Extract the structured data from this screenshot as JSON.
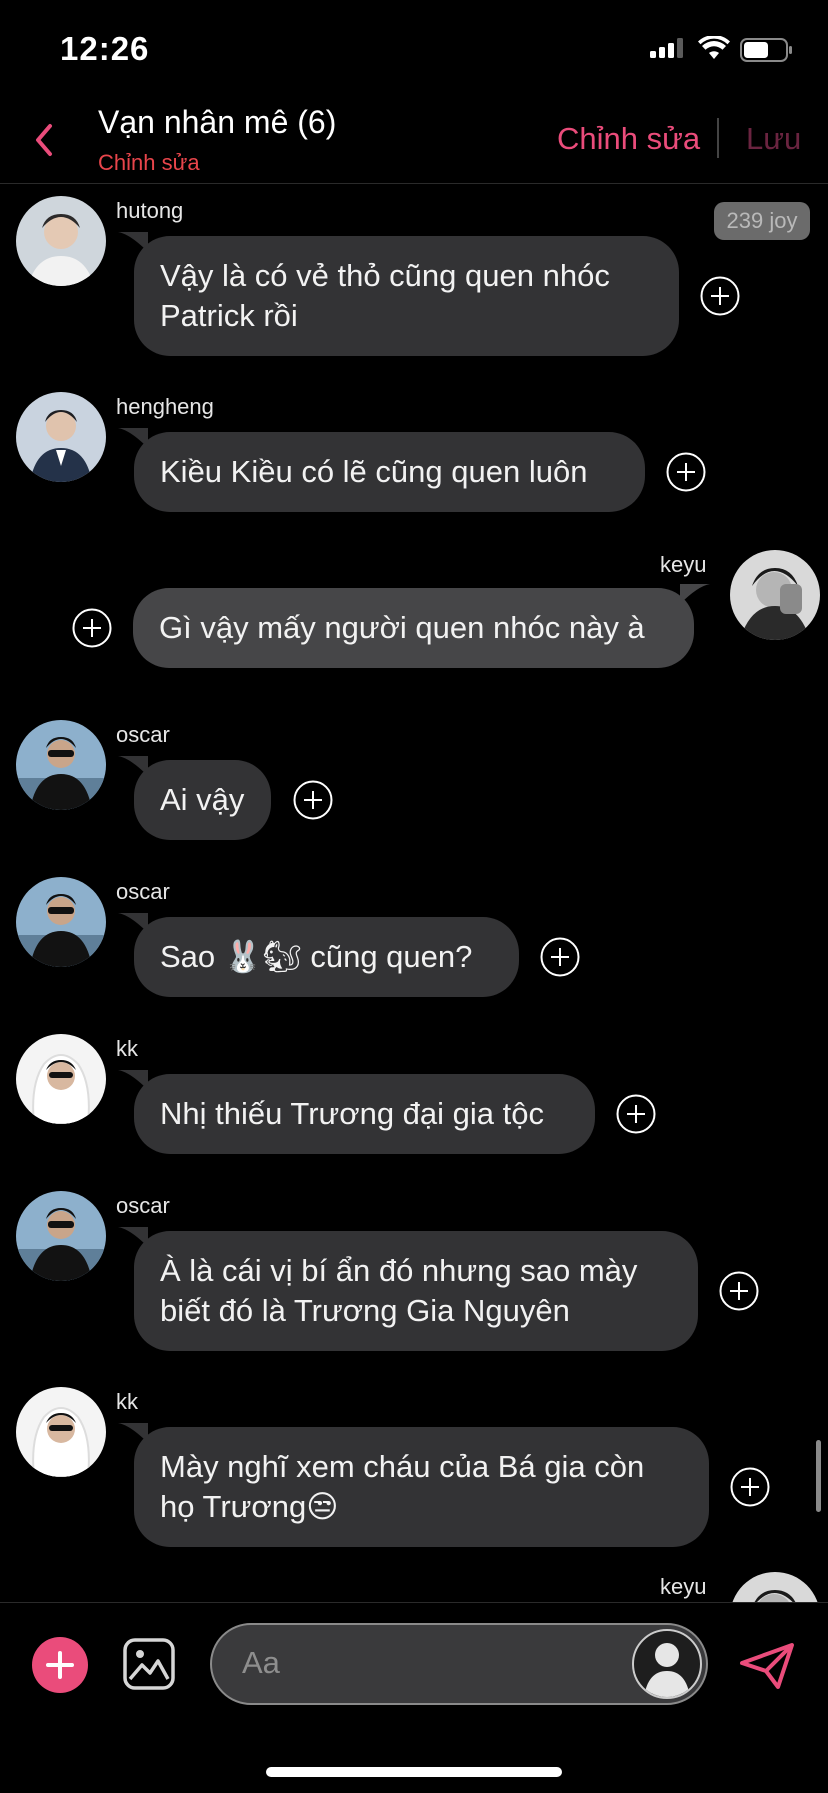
{
  "status": {
    "time": "12:26"
  },
  "header": {
    "title": "Vạn nhân mê (6)",
    "subtitle": "Chỉnh sửa",
    "edit_label": "Chỉnh sửa",
    "save_label": "Lưu"
  },
  "badge": "239 joy",
  "messages": [
    {
      "sender": "hutong",
      "text": "Vậy là có vẻ thỏ cũng quen nhóc Patrick rồi",
      "side": "left"
    },
    {
      "sender": "hengheng",
      "text": "Kiều Kiều có lẽ cũng quen luôn",
      "side": "left"
    },
    {
      "sender": "keyu",
      "text": "Gì vậy mấy người quen nhóc này à",
      "side": "right"
    },
    {
      "sender": "oscar",
      "text": "Ai vậy",
      "side": "left"
    },
    {
      "sender": "oscar",
      "text": "Sao 🐰🐿 cũng quen?",
      "side": "left"
    },
    {
      "sender": "kk",
      "text": "Nhị thiếu Trương đại gia tộc",
      "side": "left"
    },
    {
      "sender": "oscar",
      "text": "À là cái vị bí ẩn đó nhưng sao mày biết đó là Trương Gia Nguyên",
      "side": "left"
    },
    {
      "sender": "kk",
      "text": "Mày nghĩ xem cháu của Bá gia còn họ Trương😒",
      "side": "left"
    },
    {
      "sender": "keyu",
      "text": "",
      "side": "right"
    }
  ],
  "composer": {
    "placeholder": "Aa"
  },
  "colors": {
    "accent": "#ea4c7b",
    "bubble": "#333335",
    "bubble_self": "#464648",
    "background": "#000000"
  },
  "icons": [
    "back-chevron-icon",
    "plus-circle-icon",
    "image-icon",
    "send-icon",
    "signal-icon",
    "wifi-icon",
    "battery-icon"
  ]
}
